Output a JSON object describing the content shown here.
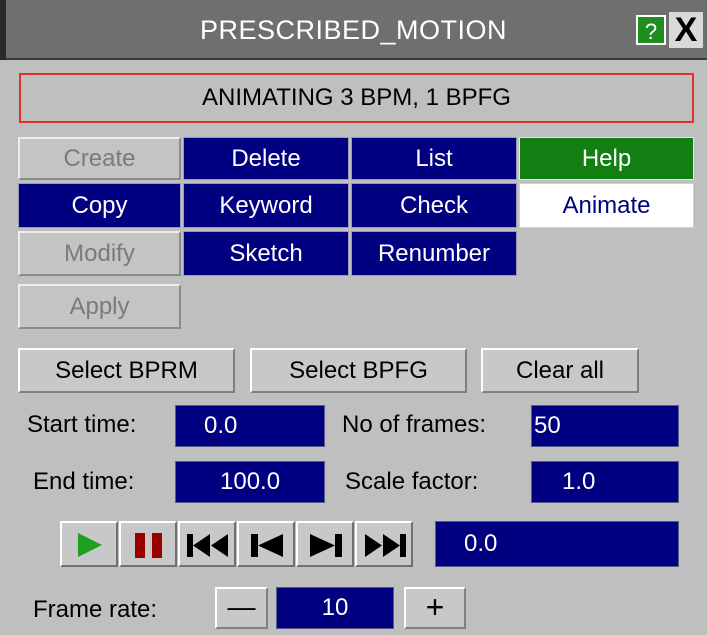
{
  "window": {
    "title": "PRESCRIBED_MOTION",
    "help_label": "?",
    "close_label": "X"
  },
  "status": "ANIMATING 3 BPM, 1 BPFG",
  "actions": {
    "create": "Create",
    "delete": "Delete",
    "list": "List",
    "help": "Help",
    "copy": "Copy",
    "keyword": "Keyword",
    "check": "Check",
    "animate": "Animate",
    "modify": "Modify",
    "sketch": "Sketch",
    "renumber": "Renumber",
    "apply": "Apply"
  },
  "selection": {
    "select_bprm": "Select BPRM",
    "select_bpfg": "Select BPFG",
    "clear_all": "Clear all"
  },
  "params": {
    "start_time_label": "Start time:",
    "start_time": "0.0",
    "frames_label": "No of frames:",
    "frames": "50",
    "end_time_label": "End time:",
    "end_time": "100.0",
    "scale_label": "Scale factor:",
    "scale": "1.0"
  },
  "playback": {
    "current_time": "0.0",
    "icons": [
      "play-icon",
      "pause-icon",
      "rewind-icon",
      "step-back-icon",
      "step-forward-icon",
      "fast-forward-icon"
    ]
  },
  "frame_rate": {
    "label": "Frame rate:",
    "value": "10",
    "minus": "—",
    "plus": "+"
  },
  "colors": {
    "dark_button": "#000080",
    "disabled_text": "#7b7b7b",
    "help_green": "#127f12",
    "play_green": "#1ea01e",
    "pause_red": "#9a0000",
    "status_border": "#e23030"
  }
}
